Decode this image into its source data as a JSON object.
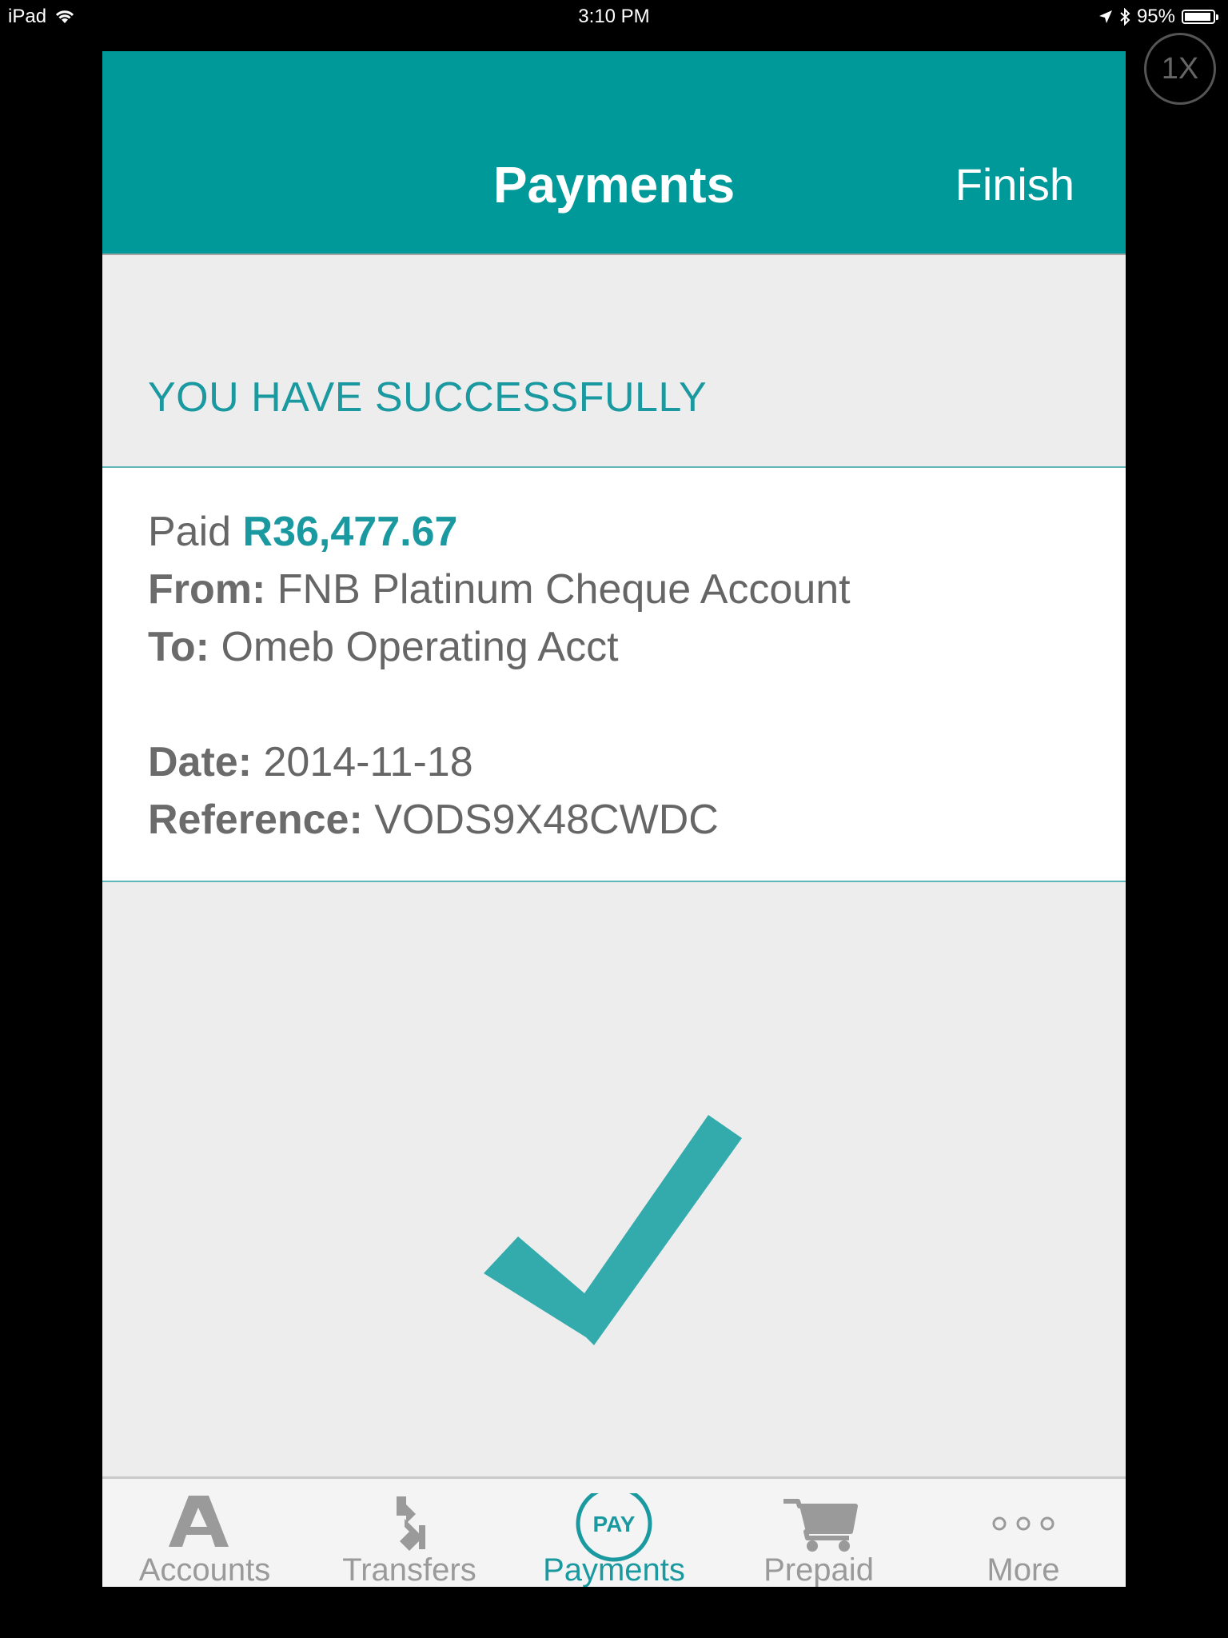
{
  "status_bar": {
    "device": "iPad",
    "time": "3:10 PM",
    "battery": "95%",
    "battery_level": 0.95
  },
  "zoom_button": {
    "label": "1X"
  },
  "nav": {
    "title": "Payments",
    "finish_label": "Finish"
  },
  "result": {
    "heading": "YOU HAVE SUCCESSFULLY",
    "paid_label": "Paid",
    "amount": "R36,477.67",
    "from_label": "From:",
    "from_value": "FNB Platinum Cheque Account",
    "to_label": "To:",
    "to_value": "Omeb Operating Acct",
    "date_label": "Date:",
    "date_value": "2014-11-18",
    "reference_label": "Reference:",
    "reference_value": "VODS9X48CWDC"
  },
  "tabs": [
    {
      "label": "Accounts",
      "icon": "accounts-a-icon",
      "active": false
    },
    {
      "label": "Transfers",
      "icon": "transfers-arrows-icon",
      "active": false
    },
    {
      "label": "Payments",
      "icon": "pay-circle-icon",
      "icon_text": "PAY",
      "active": true
    },
    {
      "label": "Prepaid",
      "icon": "cart-icon",
      "active": false
    },
    {
      "label": "More",
      "icon": "more-dots-icon",
      "active": false
    }
  ],
  "colors": {
    "accent": "#00999a",
    "accent_text": "#1a9aa0",
    "check": "#33aaab",
    "background": "#ededed",
    "tab_inactive": "#9a9a9a"
  }
}
